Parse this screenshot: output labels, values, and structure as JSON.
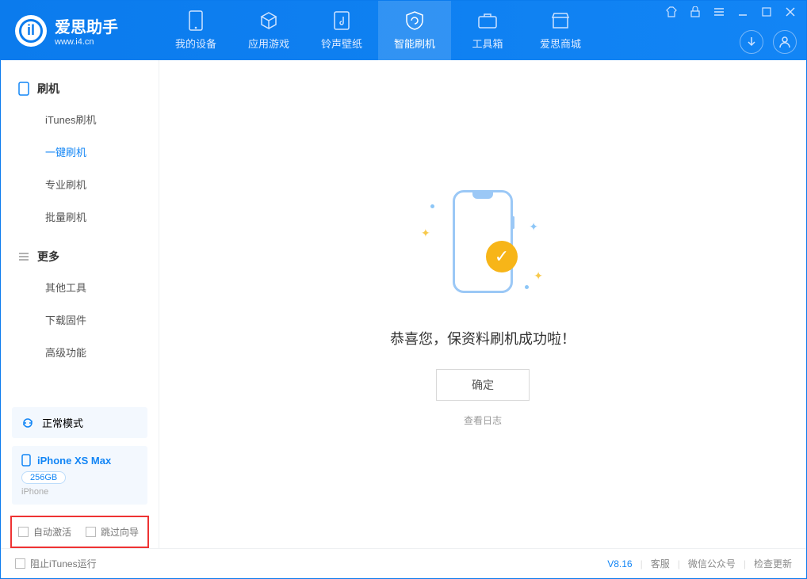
{
  "brand": {
    "name": "爱思助手",
    "url": "www.i4.cn"
  },
  "tabs": [
    {
      "label": "我的设备"
    },
    {
      "label": "应用游戏"
    },
    {
      "label": "铃声壁纸"
    },
    {
      "label": "智能刷机"
    },
    {
      "label": "工具箱"
    },
    {
      "label": "爱思商城"
    }
  ],
  "sidebar": {
    "sectionA": "刷机",
    "itemsA": [
      "iTunes刷机",
      "一键刷机",
      "专业刷机",
      "批量刷机"
    ],
    "sectionB": "更多",
    "itemsB": [
      "其他工具",
      "下载固件",
      "高级功能"
    ]
  },
  "device": {
    "modeLabel": "正常模式",
    "name": "iPhone XS Max",
    "capacity": "256GB",
    "type": "iPhone"
  },
  "checkboxes": {
    "autoActivate": "自动激活",
    "skipGuide": "跳过向导"
  },
  "main": {
    "successMessage": "恭喜您，保资料刷机成功啦！",
    "okButton": "确定",
    "logLink": "查看日志"
  },
  "statusbar": {
    "blockITunes": "阻止iTunes运行",
    "version": "V8.16",
    "support": "客服",
    "wechat": "微信公众号",
    "update": "检查更新"
  }
}
